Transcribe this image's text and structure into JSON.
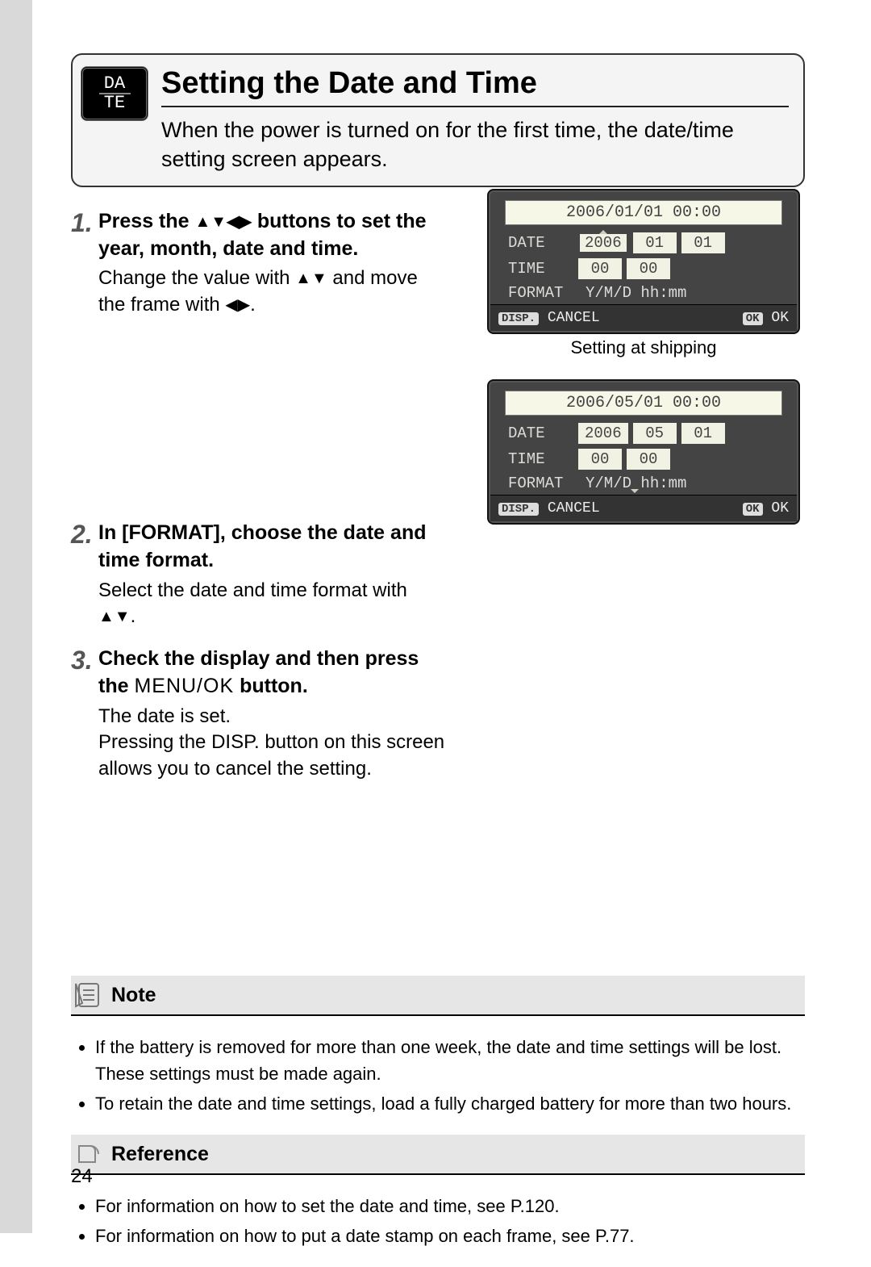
{
  "header": {
    "icon_label": "DA\\nTE",
    "title": "Setting the Date and Time",
    "intro": "When the power is turned on for the first time, the date/time setting screen appears."
  },
  "steps": [
    {
      "num": "1.",
      "head_pre": "Press the ",
      "head_post": " buttons to set the year, month, date and time.",
      "text_a": "Change the value with ",
      "text_b": " and move the frame with ",
      "text_c": "."
    },
    {
      "num": "2.",
      "head": "In [FORMAT], choose the date and time format.",
      "text_a": "Select the date and time format with ",
      "text_b": "."
    },
    {
      "num": "3.",
      "head_pre": "Check the display and then press the ",
      "head_btn": "MENU/OK",
      "head_post": " button.",
      "text": "The date is set.\nPressing the DISP. button on this screen allows you to cancel the setting."
    }
  ],
  "screen1": {
    "top": "2006/01/01  00:00",
    "date_label": "DATE",
    "year": "2006",
    "month": "01",
    "day": "01",
    "time_label": "TIME",
    "hh": "00",
    "mm": "00",
    "format_label": "FORMAT",
    "format_value": "Y/M/D  hh:mm",
    "cancel": "CANCEL",
    "ok": "OK",
    "disp_badge": "DISP.",
    "ok_badge": "OK"
  },
  "caption1": "Setting at shipping",
  "screen2": {
    "top": "2006/05/01  00:00",
    "date_label": "DATE",
    "year": "2006",
    "month": "05",
    "day": "01",
    "time_label": "TIME",
    "hh": "00",
    "mm": "00",
    "format_label": "FORMAT",
    "format_value": "Y/M/D  hh:mm",
    "cancel": "CANCEL",
    "ok": "OK",
    "disp_badge": "DISP.",
    "ok_badge": "OK"
  },
  "note": {
    "title": "Note",
    "bullets": [
      "If the battery is removed for more than one week, the date and time settings will be lost. These settings must be made again.",
      "To retain the date and time settings, load a fully charged battery for more than two hours."
    ]
  },
  "reference": {
    "title": "Reference",
    "bullets": [
      "For information on how to set the date and time, see P.120.",
      "For information on how to put a date stamp on each frame, see P.77."
    ]
  },
  "page_number": "24"
}
